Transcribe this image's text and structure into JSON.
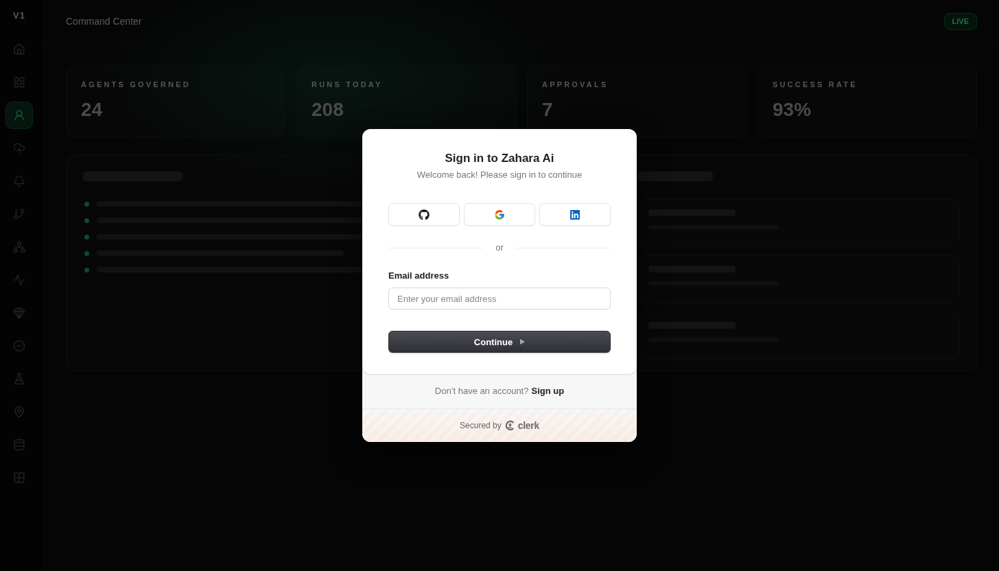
{
  "sidebar": {
    "logo": "V1",
    "items": [
      {
        "selected": false
      },
      {
        "selected": false
      },
      {
        "selected": true
      },
      {
        "selected": false
      },
      {
        "selected": false
      },
      {
        "selected": false
      },
      {
        "selected": false
      },
      {
        "selected": false
      },
      {
        "selected": false
      },
      {
        "selected": false
      },
      {
        "selected": false
      },
      {
        "selected": false
      },
      {
        "selected": false
      },
      {
        "selected": false
      }
    ]
  },
  "header": {
    "title": "Command Center",
    "badge": "LIVE"
  },
  "stats": [
    {
      "label": "AGENTS GOVERNED",
      "value": "24"
    },
    {
      "label": "RUNS TODAY",
      "value": "208"
    },
    {
      "label": "APPROVALS",
      "value": "7"
    },
    {
      "label": "SUCCESS RATE",
      "value": "93%"
    }
  ],
  "panel": {
    "columns": [
      {
        "kind": "list"
      },
      {
        "kind": "cards"
      }
    ]
  },
  "dialog": {
    "title": "Sign in to Zahara Ai",
    "subtitle": "Welcome back! Please sign in to continue",
    "social_buttons": [
      {
        "kind": "github"
      },
      {
        "kind": "google"
      },
      {
        "kind": "linkedin"
      }
    ],
    "divider": "or",
    "email": {
      "label": "Email address",
      "placeholder": "Enter your email address"
    },
    "submit": "Continue",
    "footer": {
      "text": "Don’t have an account?",
      "link": "Sign up"
    },
    "secured_by": {
      "text": "Secured by",
      "brand": "clerk"
    }
  }
}
